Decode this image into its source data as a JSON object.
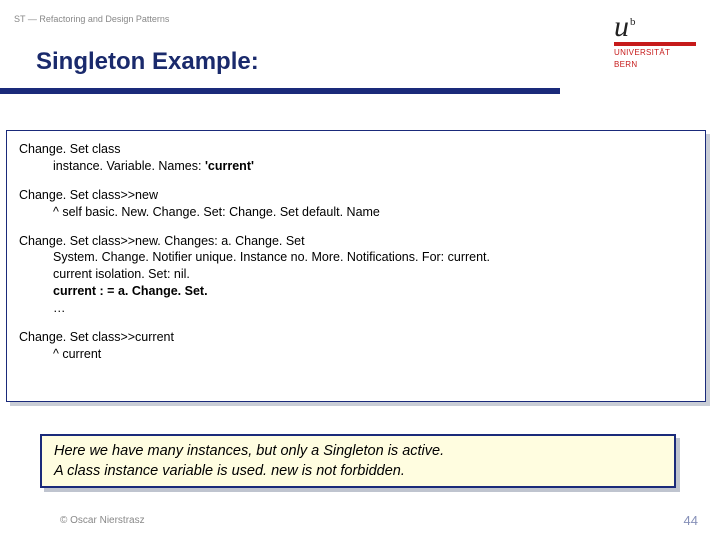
{
  "header": {
    "breadcrumb": "ST — Refactoring and Design Patterns",
    "title": "Singleton Example:",
    "logo": {
      "mark": "u",
      "sup": "b",
      "line1": "UNIVERSITÄT",
      "line2": "BERN"
    }
  },
  "code": {
    "b1_l1": "Change. Set class",
    "b1_l2_pre": "instance. Variable. Names: ",
    "b1_l2_bold": "'current'",
    "b2_l1": "Change. Set class>>new",
    "b2_l2": "^ self basic. New. Change. Set: Change. Set default. Name",
    "b3_l1": "Change. Set class>>new. Changes: a. Change. Set",
    "b3_l2": "System. Change. Notifier unique. Instance no. More. Notifications. For: current.",
    "b3_l3": "current isolation. Set: nil.",
    "b3_l4": "current : = a. Change. Set.",
    "b3_l5": "…",
    "b4_l1": "Change. Set class>>current",
    "b4_l2": "^ current"
  },
  "note": {
    "line1": "Here we have many instances, but only a Singleton is active.",
    "line2": "A class instance variable is used. new is not forbidden."
  },
  "footer": {
    "copyright": "© Oscar Nierstrasz",
    "page": "44"
  }
}
